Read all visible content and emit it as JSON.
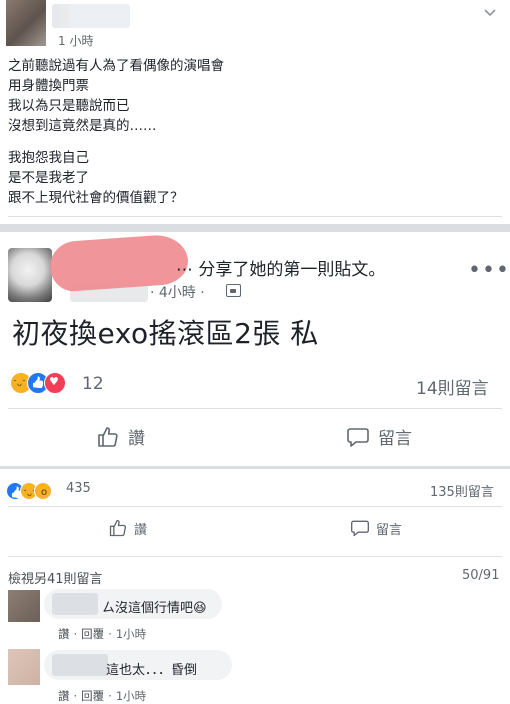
{
  "top_post": {
    "time": "1 小時",
    "paragraph1": [
      "之前聽說過有人為了看偶像的演唱會",
      "用身體換門票",
      "我以為只是聽說而已",
      "沒想到這竟然是真的……"
    ],
    "paragraph2": [
      "我抱怨我自己",
      "是不是我老了",
      "跟不上現代社會的價值觀了？"
    ]
  },
  "shared_post": {
    "shared_text": "⋯ 分享了她的第一則貼文。",
    "meta_time": "· 4小時 ·",
    "content": "初夜換exo搖滾區2張 私",
    "reaction_count": "12",
    "comment_count": "14則留言",
    "like_label": "讚",
    "comment_label": "留言"
  },
  "outer_post": {
    "reaction_count": "435",
    "comment_count": "135則留言",
    "like_label": "讚",
    "comment_label": "留言"
  },
  "comments_section": {
    "view_more": "檢視另41則留言",
    "paging": "50/91",
    "comments": [
      {
        "text": "ㄙ沒這個行情吧😆",
        "like": "讚",
        "reply": "回覆",
        "time": "1小時"
      },
      {
        "text": "這也太．．．昏倒",
        "like": "讚",
        "reply": "回覆",
        "time": "1小時"
      }
    ]
  }
}
